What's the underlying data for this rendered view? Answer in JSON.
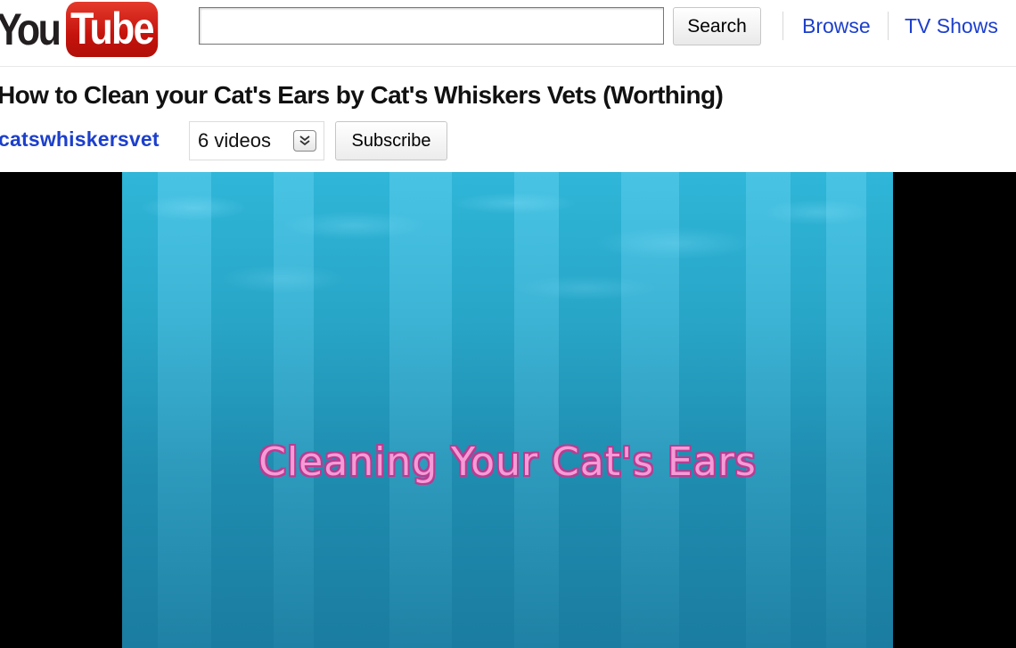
{
  "header": {
    "logo": {
      "you": "You",
      "tube": "Tube"
    },
    "search": {
      "value": "",
      "placeholder": "",
      "button_label": "Search"
    },
    "nav": [
      {
        "label": "Browse"
      },
      {
        "label": "TV Shows"
      }
    ]
  },
  "video": {
    "title": "How to Clean your Cat's Ears by Cat's Whiskers Vets (Worthing)",
    "channel": "catswhiskersvet",
    "videos_count_label": "6 videos",
    "subscribe_label": "Subscribe"
  },
  "player": {
    "caption": "Cleaning Your Cat's Ears"
  },
  "icons": {
    "expand": "chevron-double-down-icon",
    "logo": "youtube-logo"
  },
  "colors": {
    "link": "#1c3fcc",
    "logo_red": "#d4190f",
    "caption_pink": "#f59ad6",
    "water_blue": "#28a6c8"
  }
}
